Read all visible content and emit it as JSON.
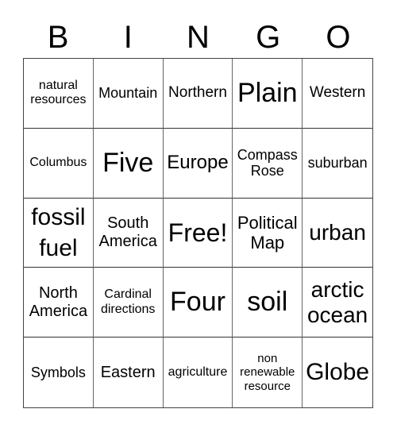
{
  "header": {
    "letters": [
      "B",
      "I",
      "N",
      "G",
      "O"
    ]
  },
  "cells": [
    [
      "natural",
      "resources"
    ],
    [
      "Mountain"
    ],
    [
      "Northern"
    ],
    [
      "Plain"
    ],
    [
      "Western"
    ],
    [
      "Columbus"
    ],
    [
      "Five"
    ],
    [
      "Europe"
    ],
    [
      "Compass",
      "Rose"
    ],
    [
      "suburban"
    ],
    [
      "fossil",
      "fuel"
    ],
    [
      "South",
      "America"
    ],
    [
      "Free!"
    ],
    [
      "Political",
      "Map"
    ],
    [
      "urban"
    ],
    [
      "North",
      "America"
    ],
    [
      "Cardinal",
      "directions"
    ],
    [
      "Four"
    ],
    [
      "soil"
    ],
    [
      "arctic",
      "ocean"
    ],
    [
      "Symbols"
    ],
    [
      "Eastern"
    ],
    [
      "agriculture"
    ],
    [
      "non",
      "renewable",
      "resource"
    ],
    [
      "Globe"
    ]
  ]
}
